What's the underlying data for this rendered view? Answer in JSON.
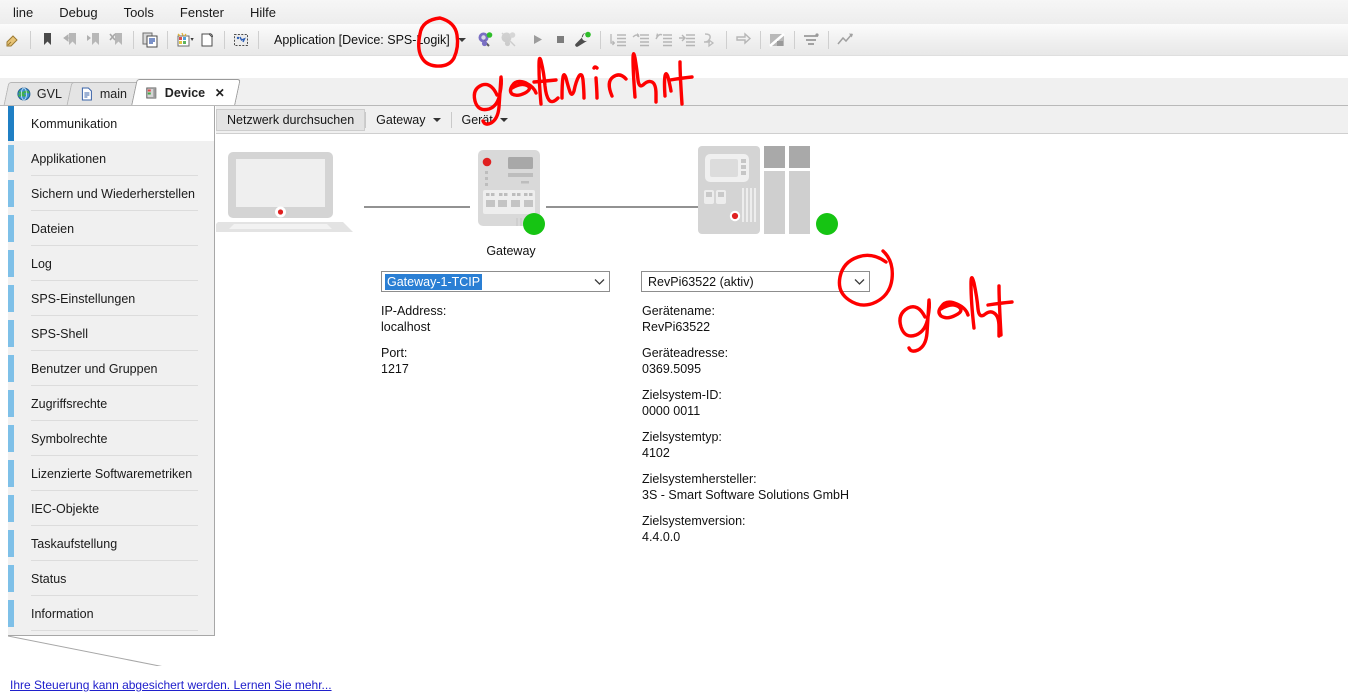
{
  "window": {
    "menu": [
      {
        "label": "line",
        "accel": ""
      },
      {
        "label": "Debug",
        "accel": "u"
      },
      {
        "label": "Tools",
        "accel": "T"
      },
      {
        "label": "Fenster",
        "accel": "F"
      },
      {
        "label": "Hilfe",
        "accel": "H"
      }
    ]
  },
  "toolbar": {
    "application_selector": "Application [Device: SPS-Logik]",
    "icons": [
      "paste-special-icon",
      "bookmark-icon",
      "previous-bookmark-icon",
      "next-bookmark-icon",
      "clear-bookmarks-icon",
      "copy-icon",
      "build-icon",
      "new-window-icon",
      "display-mode-icon",
      "login-icon",
      "logout-icon",
      "start-icon",
      "stop-icon",
      "debug-tools-icon",
      "step-over-icon",
      "step-into-icon",
      "step-out-icon",
      "run-to-cursor-icon",
      "set-next-statement-icon",
      "show-next-statement-icon",
      "toggle-breakpoint-icon",
      "breakpoints-icon",
      "write-values-icon"
    ]
  },
  "tabs": [
    {
      "label": "GVL",
      "icon": "globe-icon",
      "active": false,
      "closable": false
    },
    {
      "label": "main",
      "icon": "document-icon",
      "active": false,
      "closable": false
    },
    {
      "label": "Device",
      "icon": "device-icon",
      "active": true,
      "closable": true,
      "close_label": "✕"
    }
  ],
  "sidebar": {
    "items": [
      {
        "label": "Kommunikation",
        "selected": true
      },
      {
        "label": "Applikationen",
        "selected": false
      },
      {
        "label": "Sichern und Wiederherstellen",
        "selected": false
      },
      {
        "label": "Dateien",
        "selected": false
      },
      {
        "label": "Log",
        "selected": false
      },
      {
        "label": "SPS-Einstellungen",
        "selected": false
      },
      {
        "label": "SPS-Shell",
        "selected": false
      },
      {
        "label": "Benutzer und Gruppen",
        "selected": false
      },
      {
        "label": "Zugriffsrechte",
        "selected": false
      },
      {
        "label": "Symbolrechte",
        "selected": false
      },
      {
        "label": "Lizenzierte Softwaremetriken",
        "selected": false
      },
      {
        "label": "IEC-Objekte",
        "selected": false
      },
      {
        "label": "Taskaufstellung",
        "selected": false
      },
      {
        "label": "Status",
        "selected": false
      },
      {
        "label": "Information",
        "selected": false
      }
    ]
  },
  "pane_toolbar": {
    "scan_network": "Netzwerk durchsuchen",
    "gateway_menu": "Gateway",
    "device_menu": "Gerät"
  },
  "diagram": {
    "laptop_label": "",
    "gateway_label": "Gateway",
    "gateway_status_color": "#16c413",
    "device_status_color": "#16c413"
  },
  "gateway_panel": {
    "selector_value": "Gateway-1-TCIP",
    "fields": [
      {
        "key": "IP-Address:",
        "value": "localhost"
      },
      {
        "key": "Port:",
        "value": "1217"
      }
    ]
  },
  "device_panel": {
    "selector_value": "RevPi63522 (aktiv)",
    "fields": [
      {
        "key": "Gerätename:",
        "value": "RevPi63522"
      },
      {
        "key": "Geräteadresse:",
        "value": "0369.5095"
      },
      {
        "key": "Zielsystem-ID:",
        "value": "0000 0011"
      },
      {
        "key": "Zielsystemtyp:",
        "value": "4102"
      },
      {
        "key": "Zielsystemhersteller:",
        "value": "3S - Smart Software Solutions GmbH"
      },
      {
        "key": "Zielsystemversion:",
        "value": "4.4.0.0"
      }
    ]
  },
  "footer": {
    "security_link": "Ihre Steuerung kann abgesichert werden. Lernen Sie mehr..."
  },
  "annotations": {
    "ink_color": "#fe0000",
    "note_top": "geht nicht",
    "note_right": "geht"
  }
}
